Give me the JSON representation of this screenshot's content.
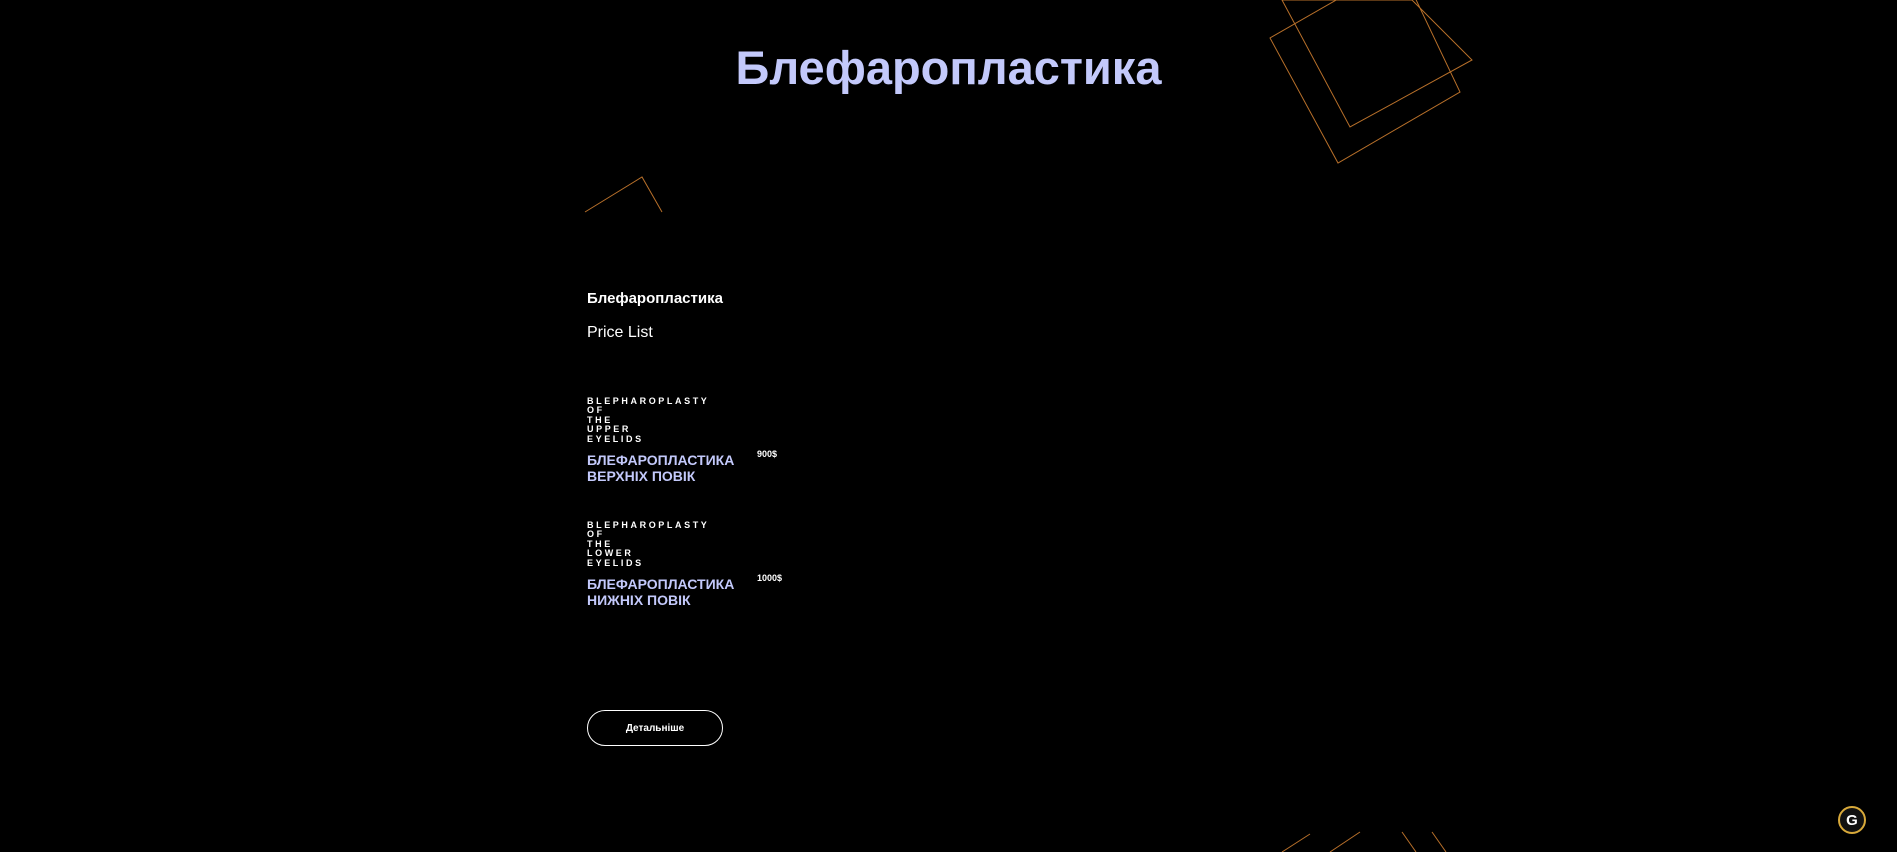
{
  "page": {
    "title": "Блефаропластика"
  },
  "section": {
    "title": "Блефаропластика",
    "subtitle": "Price List"
  },
  "price_items": [
    {
      "name_en": "Blepharoplasty of the upper eyelids",
      "name_ua": "Блефаропластика верхніх повік",
      "price": "900$"
    },
    {
      "name_en": "Blepharoplasty of the lower eyelids",
      "name_ua": "Блефаропластика нижніх повік",
      "price": "1000$"
    }
  ],
  "actions": {
    "details_label": "Детальніше"
  },
  "widget": {
    "icon": "g-logo-icon",
    "glyph": "G"
  },
  "colors": {
    "background": "#000000",
    "accent": "#c3c9fb",
    "decor_line": "#c87a2c",
    "text": "#ffffff"
  }
}
